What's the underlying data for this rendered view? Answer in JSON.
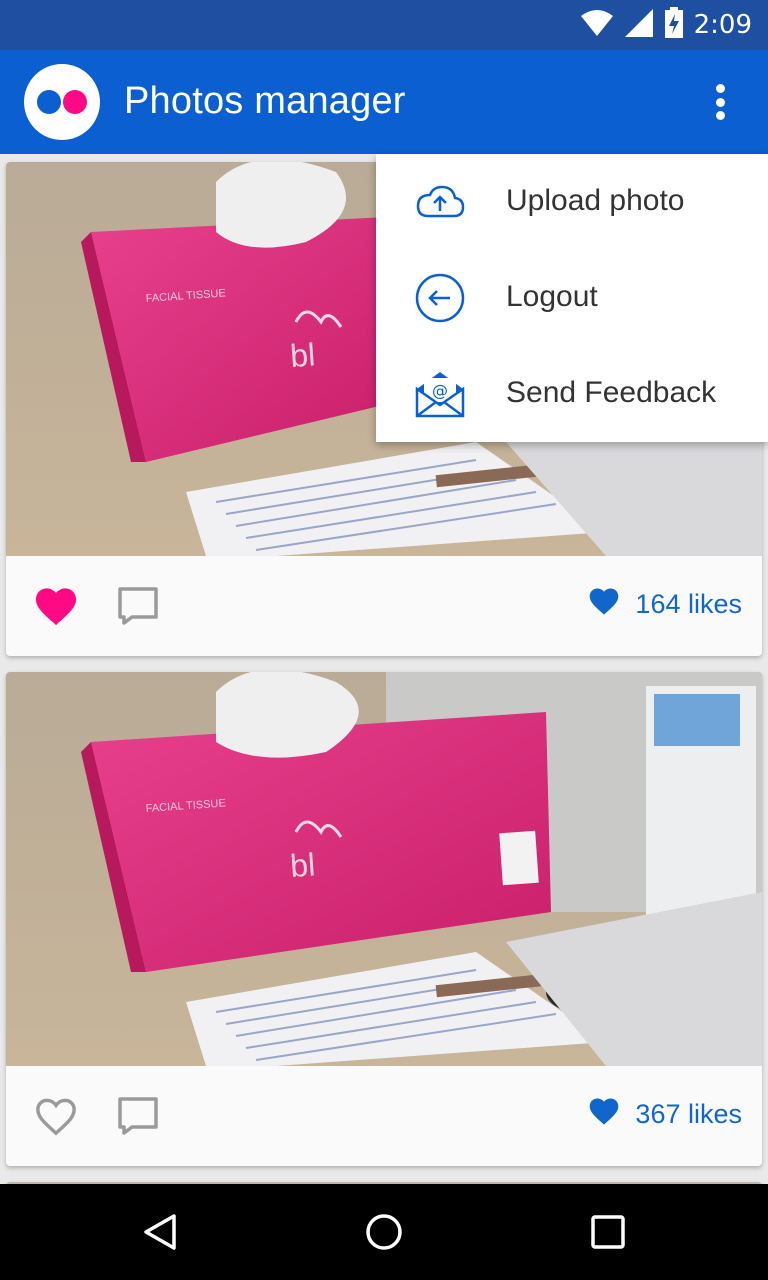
{
  "status_bar": {
    "time": "2:09",
    "icons": [
      "wifi-icon",
      "cell-signal-icon",
      "battery-charging-icon"
    ]
  },
  "app_bar": {
    "title": "Photos manager",
    "logo": "flickr-logo",
    "overflow_icon": "more-vert-icon"
  },
  "menu": {
    "items": [
      {
        "label": "Upload photo",
        "icon": "cloud-upload-icon"
      },
      {
        "label": "Logout",
        "icon": "arrow-back-circle-icon"
      },
      {
        "label": "Send Feedback",
        "icon": "email-icon"
      }
    ]
  },
  "feed": {
    "posts": [
      {
        "likes_text": "164 likes",
        "liked": true
      },
      {
        "likes_text": "367 likes",
        "liked": false
      }
    ]
  },
  "colors": {
    "status_bar": "#1f4fa0",
    "app_bar": "#0b5fd1",
    "accent_pink": "#ff0a84",
    "likes_blue": "#1166cc"
  },
  "nav_bar": {
    "buttons": [
      "back-icon",
      "home-icon",
      "recents-icon"
    ]
  }
}
